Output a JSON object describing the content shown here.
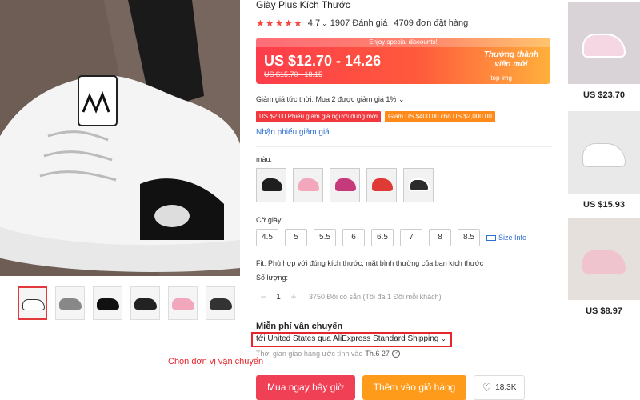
{
  "product": {
    "title": "Giày Plus Kích Thước",
    "rating": "4.7",
    "reviews": "1907 Đánh giá",
    "orders": "4709 đơn đặt hàng",
    "stars": "★★★★★"
  },
  "price": {
    "promo": "Enjoy special discounts!",
    "current": "US $12.70 - 14.26",
    "original": "US $15.70 - 18.15",
    "badge": "Thường thành viên mới",
    "badge_img": "top-img"
  },
  "discounts": {
    "instant": "Giảm giá tức thời: Mua 2 được giảm giá 1%",
    "coupon_new": "US $2.00 Phiếu giảm giá người dùng mới",
    "coupon_store": "Giảm US $400.00 cho US $2,000.00",
    "get_coupon": "Nhận phiếu giảm giá"
  },
  "color": {
    "label": "màu:",
    "swatches": [
      "#1f1f1f",
      "#f2a7bd",
      "#c43a7a",
      "#e03a36",
      "#2b2b2b"
    ]
  },
  "size": {
    "label": "Cỡ giày:",
    "options": [
      "4.5",
      "5",
      "5.5",
      "6",
      "6.5",
      "7",
      "8",
      "8.5"
    ],
    "info": "Size Info"
  },
  "fit": "Fit: Phù hợp với đúng kích thước, mặt bình thường của bạn kích thước",
  "quantity": {
    "label": "Số lượng:",
    "value": "1",
    "minus": "−",
    "plus": "+",
    "available": "3750 Đôi có sẵn (Tối đa 1 Đôi mỗi khách)"
  },
  "shipping": {
    "title": "Miễn phí vận chuyển",
    "line": "tới United States qua AliExpress Standard Shipping",
    "delivery": "Thời gian giao hàng ước tính vào",
    "delivery_date": "Th.6 27",
    "annotation": "Chọn đơn vị vận chuyển"
  },
  "actions": {
    "buy": "Mua ngay bây giờ",
    "cart": "Thêm vào giỏ hàng",
    "wishlist": "18.3K"
  },
  "recommended": [
    {
      "price": "US $23.70"
    },
    {
      "price": "US $15.93"
    },
    {
      "price": "US $8.97"
    }
  ]
}
